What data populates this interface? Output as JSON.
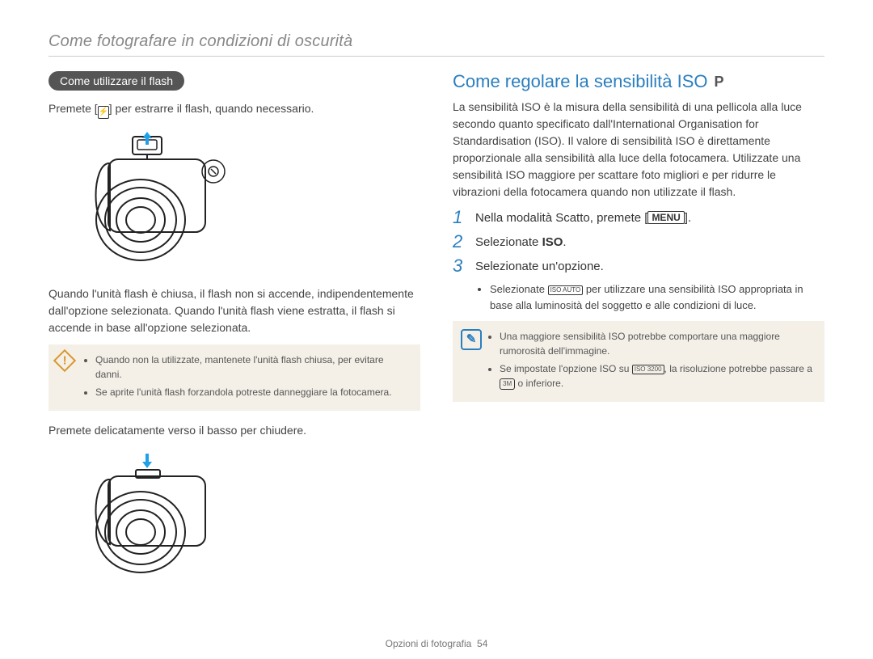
{
  "page": {
    "title": "Come fotografare in condizioni di oscurità",
    "footer_label": "Opzioni di fotografia",
    "footer_page": "54"
  },
  "left": {
    "pill": "Come utilizzare il flash",
    "line1_a": "Premete [",
    "line1_icon_glyph": "⚡",
    "line1_b": "] per estrarre il flash, quando necessario.",
    "para2": "Quando l'unità flash è chiusa, il flash non si accende, indipendentemente dall'opzione selezionata. Quando l'unità flash viene estratta, il flash si accende in base all'opzione selezionata.",
    "note1_item1": "Quando non la utilizzate, mantenete l'unità flash chiusa, per evitare danni.",
    "note1_item2": "Se aprite l'unità flash forzandola potreste danneggiare la fotocamera.",
    "para3": "Premete delicatamente verso il basso per chiudere."
  },
  "right": {
    "title": "Come regolare la sensibilità ISO",
    "mode_badge": "P",
    "intro": "La sensibilità ISO è la misura della sensibilità di una pellicola alla luce secondo quanto specificato dall'International Organisation for Standardisation (ISO). Il valore di sensibilità ISO è direttamente proporzionale alla sensibilità alla luce della fotocamera. Utilizzate una sensibilità ISO maggiore per scattare foto migliori e per ridurre le vibrazioni della fotocamera quando non utilizzate il flash.",
    "step1_a": "Nella modalità Scatto, premete [",
    "step1_menu": "MENU",
    "step1_b": "].",
    "step2_a": "Selezionate ",
    "step2_bold": "ISO",
    "step2_b": ".",
    "step3": "Selezionate un'opzione.",
    "sub_a": "Selezionate ",
    "sub_iso_badge": "ISO AUTO",
    "sub_b": " per utilizzare una sensibilità ISO appropriata in base alla luminosità del soggetto e alle condizioni di luce.",
    "note2_item1": "Una maggiore sensibilità ISO potrebbe comportare una maggiore rumorosità dell'immagine.",
    "note2_item2_a": "Se impostate l'opzione ISO su ",
    "note2_iso_badge": "ISO 3200",
    "note2_item2_b": ", la risoluzione potrebbe passare a ",
    "note2_res_badge": "3M",
    "note2_item2_c": " o inferiore."
  }
}
